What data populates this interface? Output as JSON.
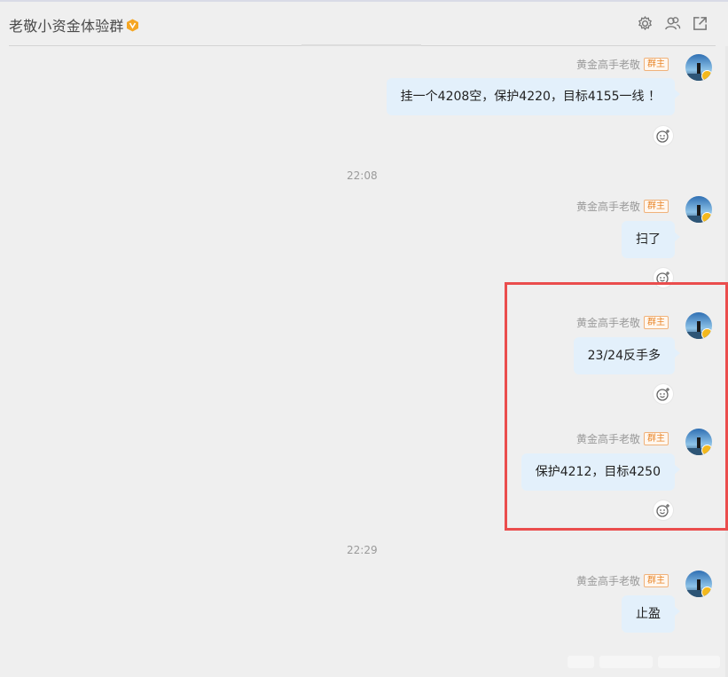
{
  "header": {
    "title": "老敬小资金体验群",
    "icons": [
      "gear-icon",
      "group-members-icon",
      "open-external-icon"
    ]
  },
  "messages": [
    {
      "sender": "黄金高手老敬",
      "role_badge": "群主",
      "text": "挂一个4208空，保护4220，目标4155一线 ！"
    },
    {
      "sender": "黄金高手老敬",
      "role_badge": "群主",
      "text": "扫了"
    },
    {
      "sender": "黄金高手老敬",
      "role_badge": "群主",
      "text": "23/24反手多"
    },
    {
      "sender": "黄金高手老敬",
      "role_badge": "群主",
      "text": "保护4212，目标4250"
    },
    {
      "sender": "黄金高手老敬",
      "role_badge": "群主",
      "text": "止盈"
    }
  ],
  "timestamps": [
    "22:08",
    "22:29"
  ],
  "colors": {
    "bubble": "#e3f0fb",
    "badge": "#e8862a",
    "highlight": "#ea4d4d",
    "background": "#efefef"
  }
}
